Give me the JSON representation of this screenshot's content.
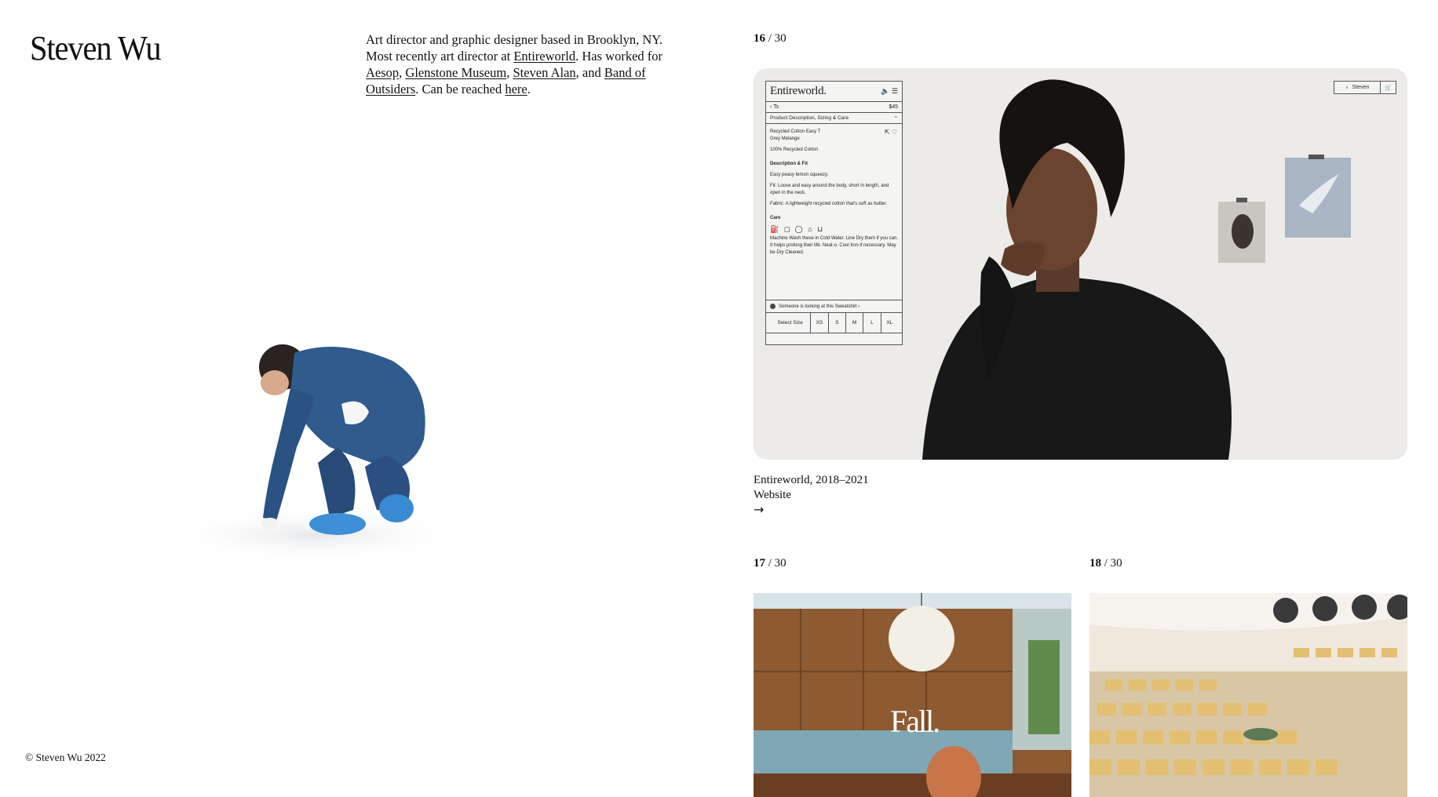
{
  "site": {
    "title": "Steven Wu",
    "copyright": "© Steven Wu 2022"
  },
  "bio": {
    "line1": "Art director and graphic designer based in Brooklyn, NY. Most recently art director at ",
    "link_entireworld": "Entireworld",
    "mid": ". Has worked for ",
    "link_aesop": "Aesop",
    "sep1": ", ",
    "link_glenstone": "Glenstone Museum",
    "sep2": ", ",
    "link_steven_alan": "Steven Alan",
    "sep3": ", and ",
    "link_band": "Band of Outsiders",
    "reach": ". Can be reached ",
    "link_here": "here",
    "end": "."
  },
  "projects": [
    {
      "index": "16",
      "total": "/ 30",
      "caption_title": "Entireworld, 2018–2021",
      "caption_type": "Website",
      "arrow": "→",
      "product_panel": {
        "brand": "Entireworld.",
        "brand_icons": "🔈 ☰",
        "back_label": "‹ Ts",
        "price": "$45",
        "accordion_label": "Product Description, Sizing & Care",
        "accordion_icon": "⌃",
        "product_name": "Recycled Cotton Easy T",
        "color": "Grey Melange",
        "material": "100% Recycled Cotton",
        "desc_heading": "Description & Fit",
        "desc_tagline": "Easy peasy lemon squeezy.",
        "fit": "Fit: Loose and easy around the body, short in length, and open in the neck.",
        "fabric": "Fabric: A lightweight recycled cotton that's soft as butter.",
        "care_heading": "Care",
        "care_icons": "⛽ ◻ ◯ ⌂ ⊔",
        "care_text": "Machine Wash these in Cold Water. Line Dry them if you can. It helps prolong their life. Neat-o. Cool Iron if necessary. May be Dry Cleaned.",
        "looking_text": "Someone is looking at this Sweatshirt ›",
        "sizes": [
          "Select Size",
          "XS",
          "S",
          "M",
          "L",
          "XL"
        ]
      },
      "account": {
        "user_label": "Steven",
        "cart_icon": "🛒"
      }
    },
    {
      "index": "17",
      "total": "/ 30",
      "overlay_text": "Fall."
    },
    {
      "index": "18",
      "total": "/ 30"
    }
  ]
}
